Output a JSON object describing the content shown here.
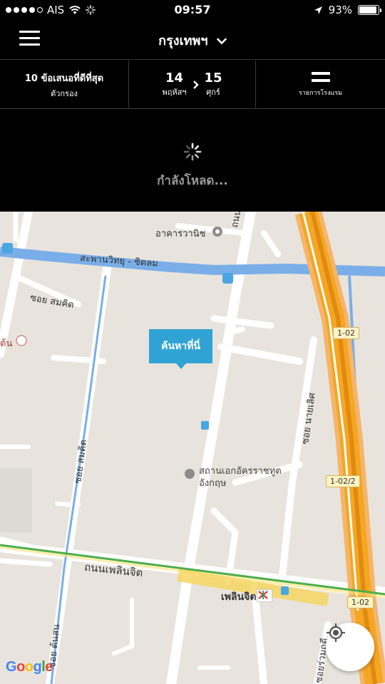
{
  "status_bar": {
    "carrier": "AIS",
    "time": "09:57",
    "battery": "93%",
    "battery_level": 0.93
  },
  "header": {
    "city": "กรุงเทพฯ"
  },
  "filter_bar": {
    "offers_label": "10 ข้อเสนอที่ดีที่สุด",
    "filter_label": "ตัวกรอง",
    "checkin_day": "14",
    "checkin_weekday": "พฤหัสฯ",
    "checkout_day": "15",
    "checkout_weekday": "ศุกร์",
    "hotel_list_label": "รายการโรงแรม"
  },
  "loading": {
    "text": "กำลังโหลด..."
  },
  "map": {
    "search_here_label": "ค้นหาที่นี่",
    "labels": {
      "building": "อาคารวานิช",
      "canal": "สะพานวิทยุ - ชิดลม",
      "soi_somkid_top": "ซอย สมคิด",
      "road_wittayu": "ถนน วิทยุ",
      "soi_somkid_vertical": "ซอย สมคิด",
      "soi_nai_lert": "ซอย นายเลิศ",
      "embassy": "สถานเอกอัครราชทูต",
      "embassy_line2": "อังกฤษ",
      "road_ploenchit": "ถนนเพลินจิต",
      "station": "เพลินจิต",
      "soi_tonson": "ซอย ต้นสน",
      "soi_ruamrudee": "ซอยร่วมฤดี",
      "hospital_fragment": "ต้น"
    },
    "shields": [
      "1-02",
      "1-02/2",
      "1-02"
    ],
    "attribution": "Google"
  },
  "colors": {
    "accent": "#30a3d4",
    "expressway": "#f5a623",
    "canal": "#7aaee8",
    "bts": "#4cae4c"
  }
}
